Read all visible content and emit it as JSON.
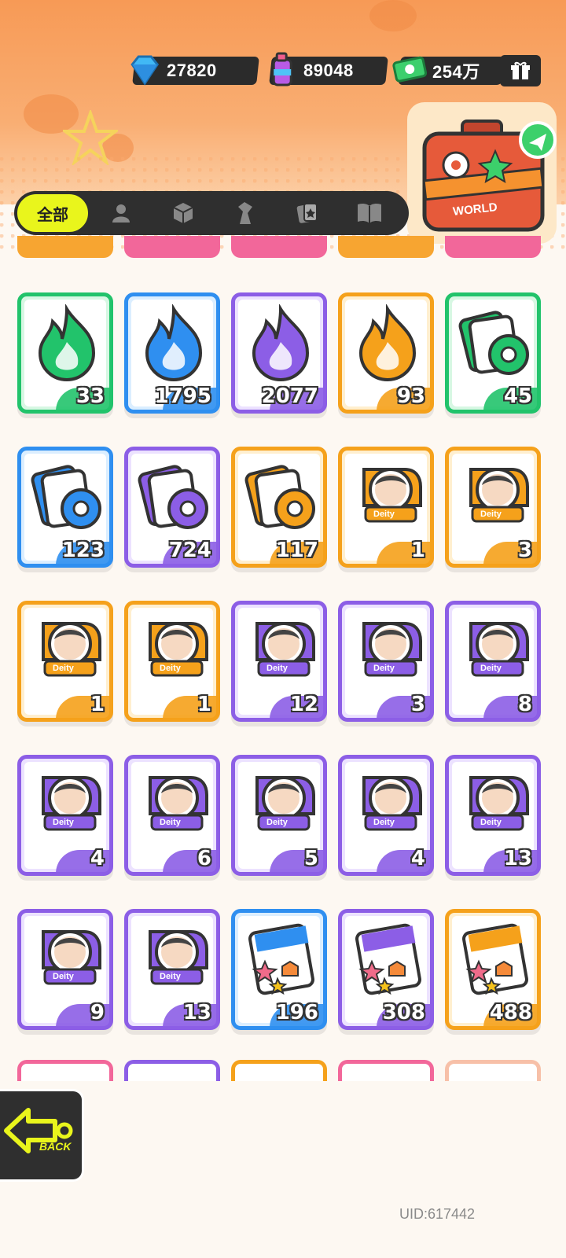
{
  "currency": {
    "gems": "27820",
    "spray": "89048",
    "cash": "254万"
  },
  "world_label": "WORLD",
  "tabs": {
    "all_label": "全部",
    "icons": [
      "person-icon",
      "box-icon",
      "figure-icon",
      "cards-icon",
      "book-icon"
    ]
  },
  "colors": {
    "green": "#22c36b",
    "blue": "#2f8ff0",
    "purple": "#8c5ee6",
    "orange": "#f5a11b",
    "accent": "#e9f51c",
    "dark": "#2f2f2f"
  },
  "items": [
    {
      "name": "green-flame",
      "rarity": "green",
      "icon": "flame-icon",
      "qty": "33"
    },
    {
      "name": "blue-flame",
      "rarity": "blue",
      "icon": "flame-icon",
      "qty": "1795"
    },
    {
      "name": "purple-flame",
      "rarity": "purple",
      "icon": "flame-icon",
      "qty": "2077"
    },
    {
      "name": "orange-flame",
      "rarity": "orange",
      "icon": "flame-icon",
      "qty": "93"
    },
    {
      "name": "green-card-roll",
      "rarity": "green",
      "icon": "card-roll-icon",
      "qty": "45"
    },
    {
      "name": "blue-card-roll",
      "rarity": "blue",
      "icon": "card-roll-icon",
      "qty": "123"
    },
    {
      "name": "purple-card-roll",
      "rarity": "purple",
      "icon": "card-roll-icon",
      "qty": "724"
    },
    {
      "name": "gold-card-roll",
      "rarity": "orange",
      "icon": "card-roll-icon",
      "qty": "117"
    },
    {
      "name": "deity-badge-1",
      "rarity": "orange",
      "icon": "deity-badge-icon",
      "qty": "1"
    },
    {
      "name": "deity-badge-2",
      "rarity": "orange",
      "icon": "deity-badge-icon",
      "qty": "3"
    },
    {
      "name": "deity-badge-3",
      "rarity": "orange",
      "icon": "deity-badge-icon",
      "qty": "1"
    },
    {
      "name": "deity-badge-4",
      "rarity": "orange",
      "icon": "deity-badge-icon",
      "qty": "1"
    },
    {
      "name": "deity-badge-5",
      "rarity": "purple",
      "icon": "deity-badge-icon",
      "qty": "12"
    },
    {
      "name": "deity-badge-6",
      "rarity": "purple",
      "icon": "deity-badge-icon",
      "qty": "3"
    },
    {
      "name": "deity-badge-7",
      "rarity": "purple",
      "icon": "deity-badge-icon",
      "qty": "8"
    },
    {
      "name": "deity-badge-8",
      "rarity": "purple",
      "icon": "deity-badge-icon",
      "qty": "4"
    },
    {
      "name": "deity-badge-9",
      "rarity": "purple",
      "icon": "deity-badge-icon",
      "qty": "6"
    },
    {
      "name": "deity-badge-10",
      "rarity": "purple",
      "icon": "deity-badge-icon",
      "qty": "5"
    },
    {
      "name": "deity-badge-11",
      "rarity": "purple",
      "icon": "deity-badge-icon",
      "qty": "4"
    },
    {
      "name": "deity-badge-12",
      "rarity": "purple",
      "icon": "deity-badge-icon",
      "qty": "13"
    },
    {
      "name": "deity-badge-13",
      "rarity": "purple",
      "icon": "deity-badge-icon",
      "qty": "9"
    },
    {
      "name": "deity-badge-14",
      "rarity": "purple",
      "icon": "deity-badge-icon",
      "qty": "13"
    },
    {
      "name": "blue-sticker-pack",
      "rarity": "blue",
      "icon": "sticker-pack-icon",
      "qty": "196"
    },
    {
      "name": "purple-sticker-pack",
      "rarity": "purple",
      "icon": "sticker-pack-icon",
      "qty": "308"
    },
    {
      "name": "gold-sticker-pack",
      "rarity": "orange",
      "icon": "sticker-pack-icon",
      "qty": "488"
    }
  ],
  "badge_text": "Deity",
  "back_label": "BACK",
  "uid": "UID:617442"
}
